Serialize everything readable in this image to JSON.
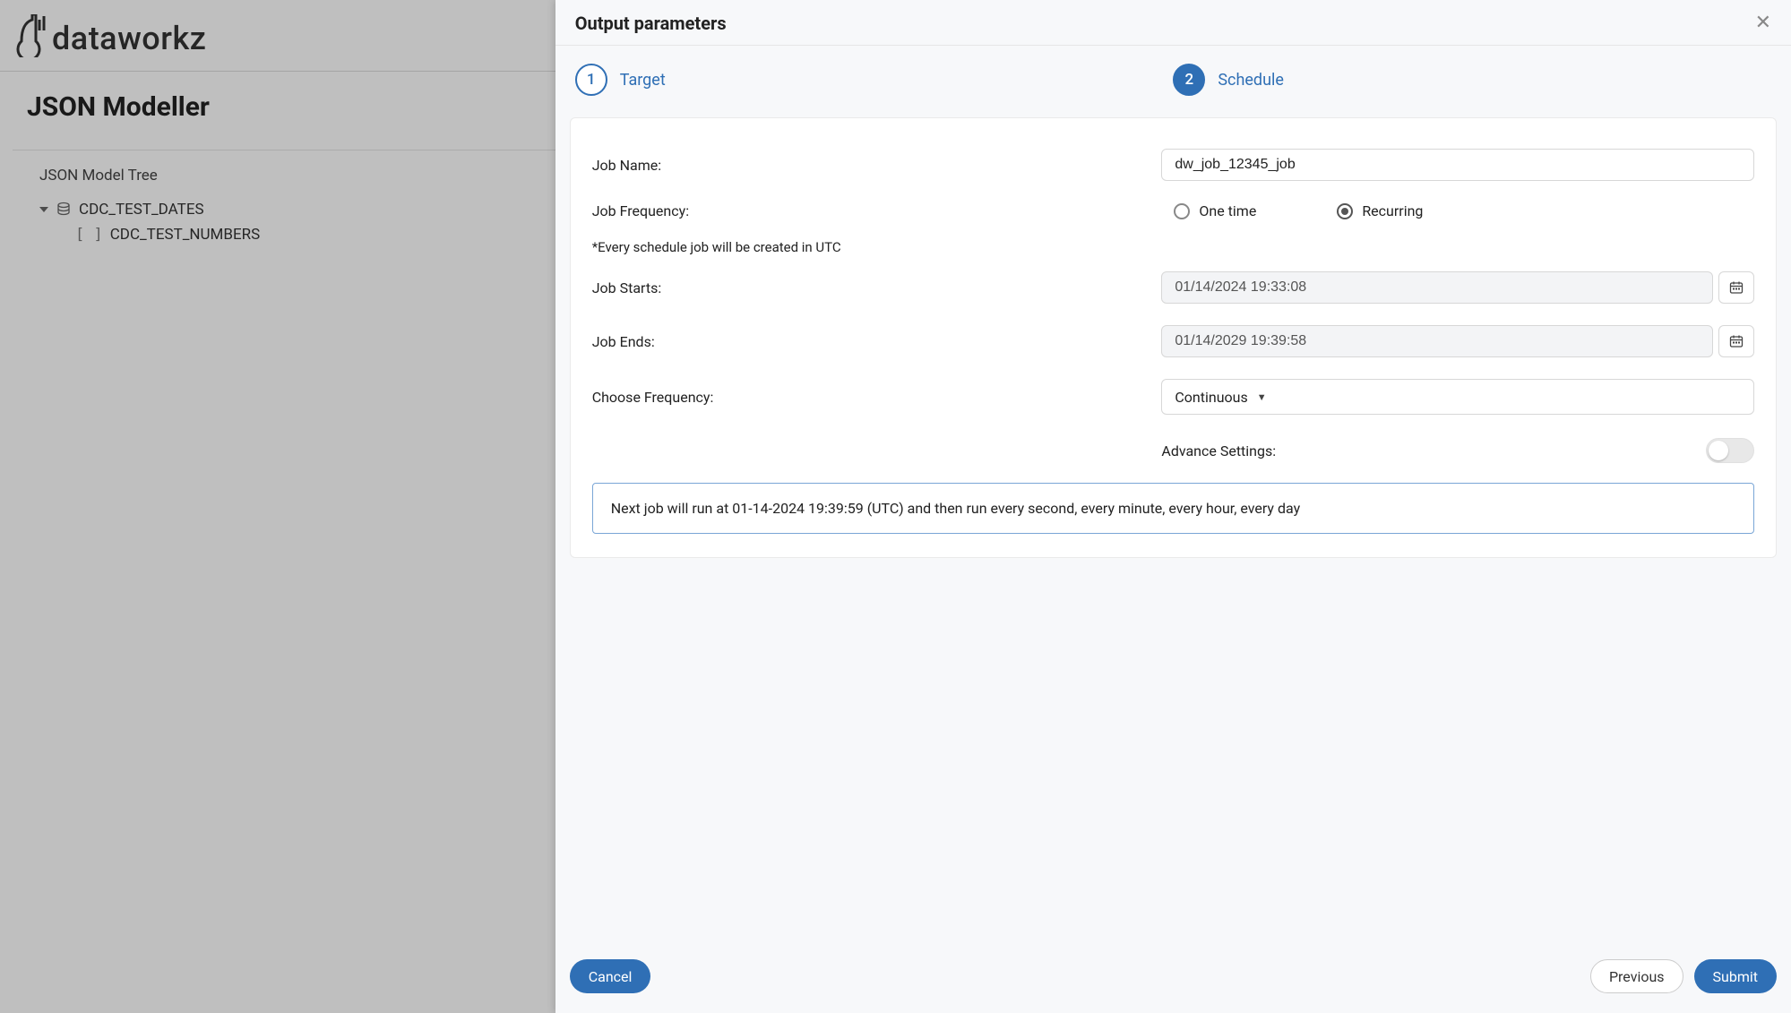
{
  "brand": {
    "name": "dataworkz"
  },
  "bg": {
    "page_title": "JSON Modeller",
    "tree_caption": "JSON Model Tree",
    "node_root": "CDC_TEST_DATES",
    "node_child": "CDC_TEST_NUMBERS"
  },
  "panel": {
    "title": "Output parameters",
    "steps": {
      "one_num": "1",
      "one_label": "Target",
      "two_num": "2",
      "two_label": "Schedule"
    },
    "form": {
      "job_name_label": "Job Name:",
      "job_name_value": "dw_job_12345_job",
      "job_freq_label": "Job Frequency:",
      "freq_one_time": "One time",
      "freq_recurring": "Recurring",
      "utc_note": "*Every schedule job will be created in UTC",
      "job_starts_label": "Job Starts:",
      "job_starts_value": "01/14/2024 19:33:08",
      "job_ends_label": "Job Ends:",
      "job_ends_value": "01/14/2029 19:39:58",
      "choose_freq_label": "Choose Frequency:",
      "choose_freq_value": "Continuous",
      "advance_label": "Advance Settings:",
      "next_run_info": "Next job will run at 01-14-2024 19:39:59 (UTC) and then run every second, every minute, every hour, every day"
    },
    "footer": {
      "cancel": "Cancel",
      "previous": "Previous",
      "submit": "Submit"
    }
  }
}
